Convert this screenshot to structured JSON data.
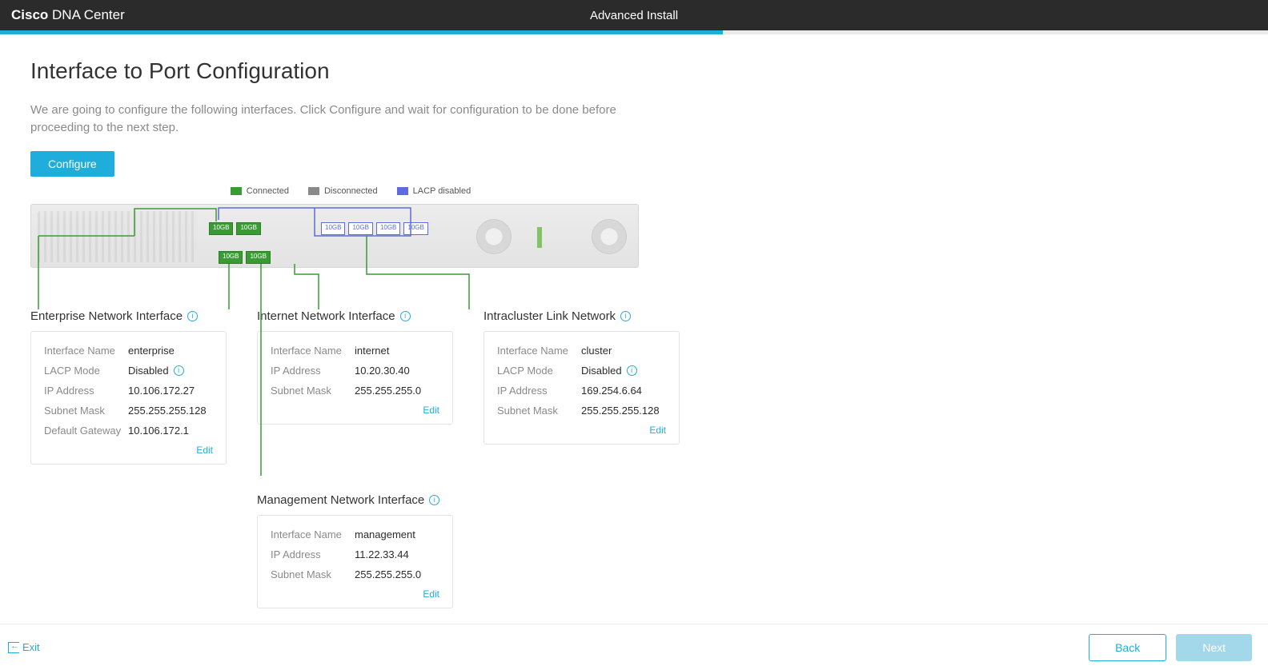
{
  "header": {
    "brand_bold": "Cisco",
    "brand_light": "DNA Center",
    "center_title": "Advanced Install"
  },
  "page": {
    "title": "Interface to Port Configuration",
    "description": "We are going to configure the following interfaces. Click Configure and wait for configuration to be done before proceeding to the next step.",
    "configure_btn": "Configure"
  },
  "legend": {
    "connected": "Connected",
    "disconnected": "Disconnected",
    "lacp_disabled": "LACP disabled"
  },
  "ports": {
    "label": "10GB"
  },
  "labels": {
    "interface_name": "Interface Name",
    "lacp_mode": "LACP Mode",
    "ip_address": "IP Address",
    "subnet_mask": "Subnet Mask",
    "default_gateway": "Default Gateway",
    "edit": "Edit"
  },
  "interfaces": {
    "enterprise": {
      "title": "Enterprise Network Interface",
      "name": "enterprise",
      "lacp": "Disabled",
      "ip": "10.106.172.27",
      "mask": "255.255.255.128",
      "gateway": "10.106.172.1"
    },
    "internet": {
      "title": "Internet Network Interface",
      "name": "internet",
      "ip": "10.20.30.40",
      "mask": "255.255.255.0"
    },
    "intracluster": {
      "title": "Intracluster Link Network",
      "name": "cluster",
      "lacp": "Disabled",
      "ip": "169.254.6.64",
      "mask": "255.255.255.128"
    },
    "management": {
      "title": "Management Network Interface",
      "name": "management",
      "ip": "11.22.33.44",
      "mask": "255.255.255.0"
    }
  },
  "footer": {
    "exit": "Exit",
    "back": "Back",
    "next": "Next"
  }
}
